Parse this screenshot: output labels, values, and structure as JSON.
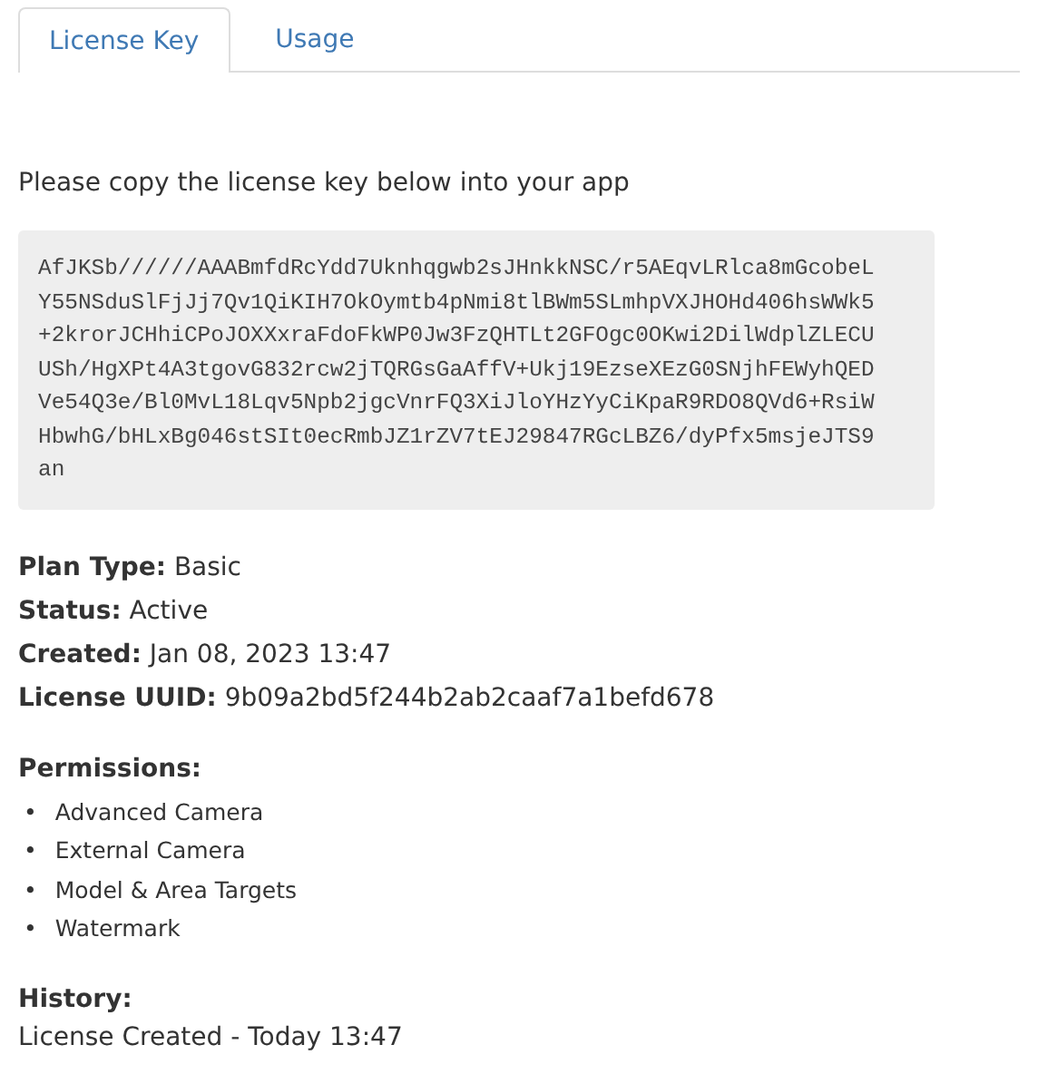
{
  "tabs": [
    {
      "label": "License Key",
      "selected": true
    },
    {
      "label": "Usage",
      "selected": false
    }
  ],
  "instruction": "Please copy the license key below into your app",
  "license_key_lines": [
    "AfJKSb//////AAABmfdRcYdd7Uknhqgwb2sJHnkkNSC/r5AEqvLRlca8mGcobeL",
    "Y55NSduSlFjJj7Qv1QiKIH7OkOymtb4pNmi8tlBWm5SLmhpVXJHOHd406hsWWk5",
    "+2krorJCHhiCPoJOXXxraFdoFkWP0Jw3FzQHTLt2GFOgc0OKwi2DilWdplZLECU",
    "USh/HgXPt4A3tgovG832rcw2jTQRGsGaAffV+Ukj19EzseXEzG0SNjhFEWyhQED",
    "Ve54Q3e/Bl0MvL18Lqv5Npb2jgcVnrFQ3XiJloYHzYyCiKpaR9RDO8QVd6+RsiW",
    "HbwhG/bHLxBg046stSIt0ecRmbJZ1rZV7tEJ29847RGcLBZ6/dyPfx5msjeJTS9",
    "an"
  ],
  "details": [
    {
      "label": "Plan Type:",
      "value": "Basic"
    },
    {
      "label": "Status:",
      "value": "Active"
    },
    {
      "label": "Created:",
      "value": "Jan 08, 2023 13:47"
    },
    {
      "label": "License UUID:",
      "value": "9b09a2bd5f244b2ab2caaf7a1befd678"
    }
  ],
  "permissions": {
    "heading": "Permissions:",
    "marker": "•",
    "items": [
      "Advanced Camera",
      "External Camera",
      "Model & Area Targets",
      "Watermark"
    ]
  },
  "history": {
    "heading": "History:",
    "entries": [
      "License Created - Today 13:47"
    ]
  }
}
